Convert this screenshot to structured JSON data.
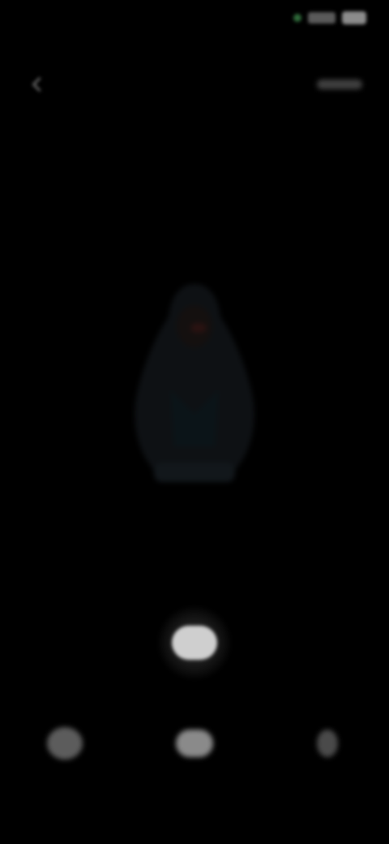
{
  "status_bar": {
    "time": "",
    "icons": [
      "signal-icon",
      "battery-icon"
    ],
    "indicator_color": "#2f6b3a"
  },
  "top_bar": {
    "back_icon": "chevron-left-icon",
    "title": "",
    "action_label": ""
  },
  "preview": {
    "subject": "hooded-figure-silhouette"
  },
  "controls": {
    "shutter_icon": "shutter-icon",
    "left_icon": "gallery-icon",
    "center_icon": "mode-icon",
    "right_icon": "switch-camera-icon"
  },
  "colors": {
    "background": "#000000",
    "text_dim": "#8e8e8e",
    "shutter": "#cfcfcf"
  }
}
